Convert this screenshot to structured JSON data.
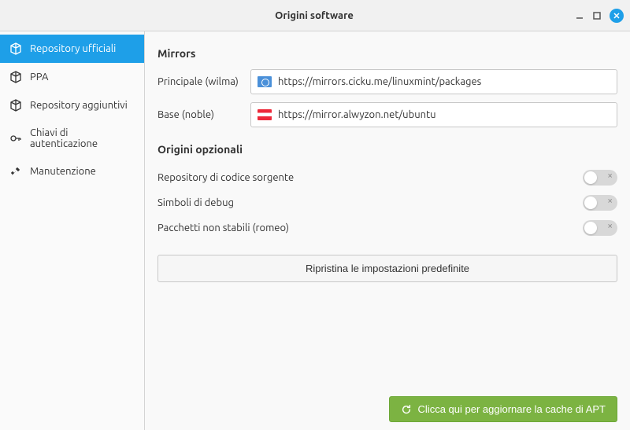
{
  "window": {
    "title": "Origini software"
  },
  "sidebar": {
    "items": [
      {
        "label": "Repository ufficiali"
      },
      {
        "label": "PPA"
      },
      {
        "label": "Repository aggiuntivi"
      },
      {
        "label": "Chiavi di autenticazione"
      },
      {
        "label": "Manutenzione"
      }
    ]
  },
  "mirrors": {
    "title": "Mirrors",
    "principal": {
      "label": "Principale (wilma)",
      "url": "https://mirrors.cicku.me/linuxmint/packages"
    },
    "base": {
      "label": "Base (noble)",
      "url": "https://mirror.alwyzon.net/ubuntu"
    }
  },
  "optional": {
    "title": "Origini opzionali",
    "items": [
      {
        "label": "Repository di codice sorgente"
      },
      {
        "label": "Simboli di debug"
      },
      {
        "label": "Pacchetti non stabili (romeo)"
      }
    ]
  },
  "buttons": {
    "reset": "Ripristina le impostazioni predefinite",
    "apt": "Clicca qui per aggiornare la cache di APT"
  }
}
